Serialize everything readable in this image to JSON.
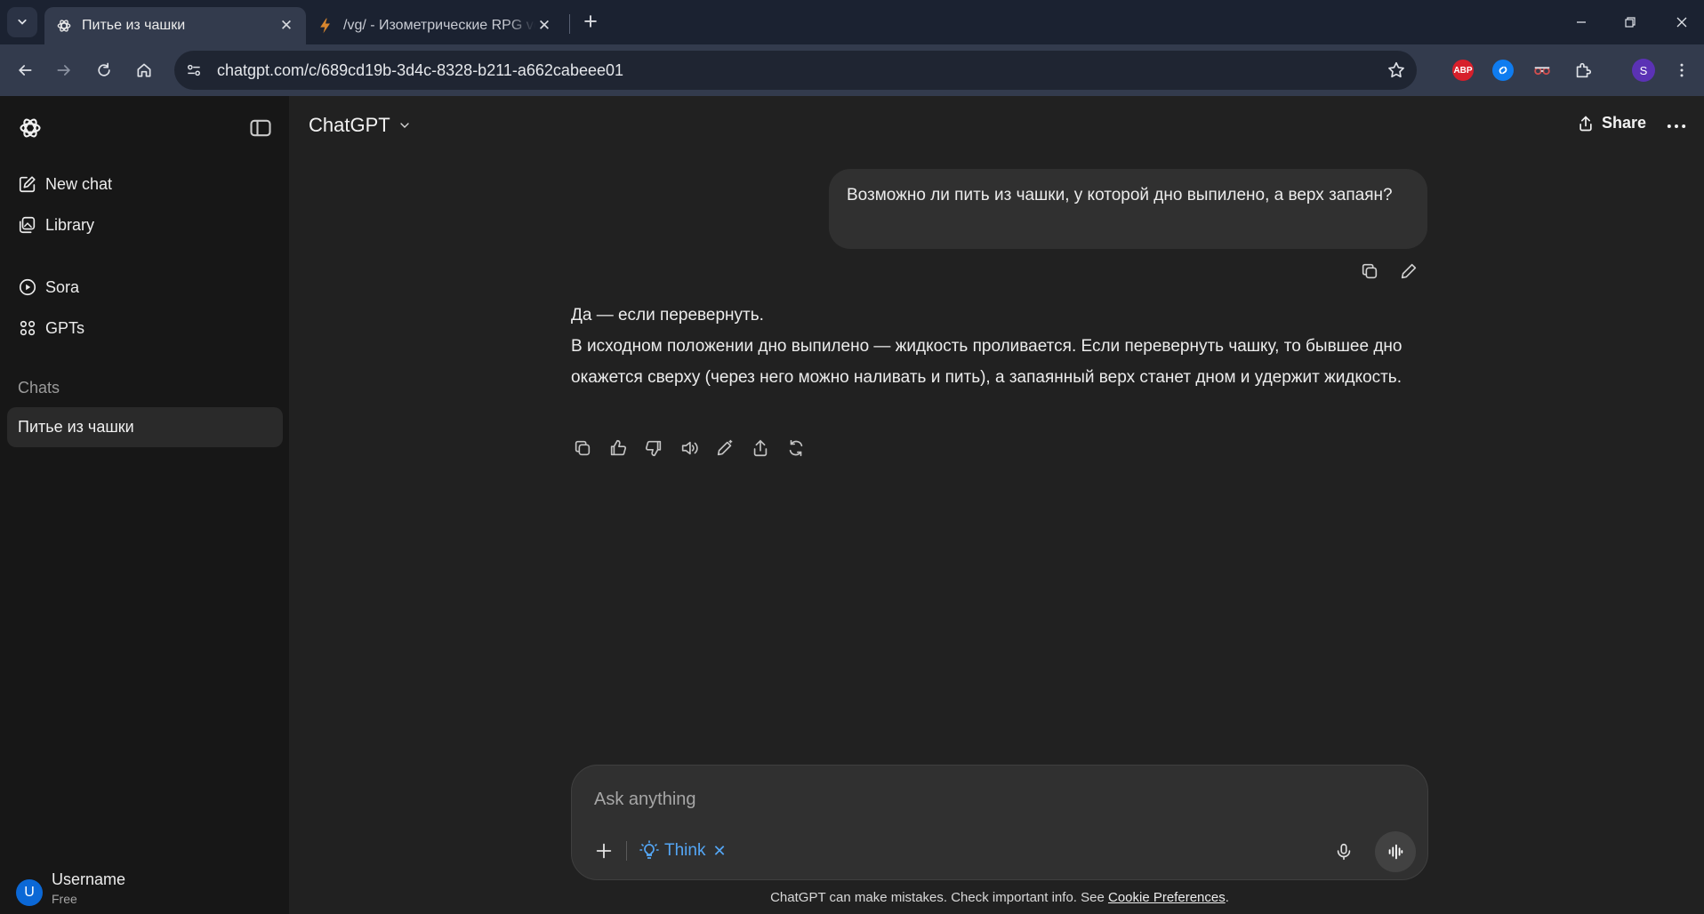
{
  "browser": {
    "tabs": [
      {
        "title": "Питье из чашки",
        "favicon": "chatgpt-logo-icon",
        "active": true
      },
      {
        "title": "/vg/ - Изометрические RPG vc",
        "favicon": "lightning-icon",
        "active": false
      }
    ],
    "url": "chatgpt.com/c/689cd19b-3d4c-8328-b211-a662cabeee01",
    "extensions": [
      {
        "name": "adblock-plus-icon",
        "label": "ABP",
        "color": "#d71f2b"
      },
      {
        "name": "shazam-icon",
        "label": "",
        "color": "#0f7cf0"
      },
      {
        "name": "glasses-extension-icon",
        "label": "",
        "color": "#d14e4e"
      },
      {
        "name": "puzzle-extensions-icon",
        "label": "",
        "color": "#dfe2e8"
      }
    ],
    "profile_initial": "S",
    "profile_color": "#5b32b5"
  },
  "sidebar": {
    "nav": [
      {
        "label": "New chat",
        "icon": "compose-icon"
      },
      {
        "label": "Library",
        "icon": "library-icon"
      },
      {
        "label": "Sora",
        "icon": "play-circle-icon"
      },
      {
        "label": "GPTs",
        "icon": "grid-icon"
      }
    ],
    "chats_label": "Chats",
    "chats": [
      {
        "title": "Питье из чашки",
        "selected": true
      }
    ],
    "user": {
      "initial": "U",
      "name": "Username",
      "plan": "Free"
    }
  },
  "header": {
    "model": "ChatGPT",
    "share_label": "Share"
  },
  "conversation": {
    "user_message": "Возможно ли пить из чашки, у которой дно выпилено, а верх запаян?",
    "assistant_message": {
      "first_line": "Да — если перевернуть.",
      "body": "В исходном положении дно выпилено — жидкость проливается. Если перевернуть чашку, то бывшее дно окажется сверху (через него можно наливать и пить), а запаянный верх станет дном и удержит жидкость."
    }
  },
  "composer": {
    "placeholder": "Ask anything",
    "think_label": "Think"
  },
  "disclaimer": {
    "text": "ChatGPT can make mistakes. Check important info. See ",
    "link": "Cookie Preferences",
    "suffix": "."
  },
  "colors": {
    "accent": "#54a6f5",
    "sidebar_bg": "#171717",
    "main_bg": "#212121",
    "bubble_bg": "#303030",
    "browser_toolbar": "#333b4d"
  }
}
